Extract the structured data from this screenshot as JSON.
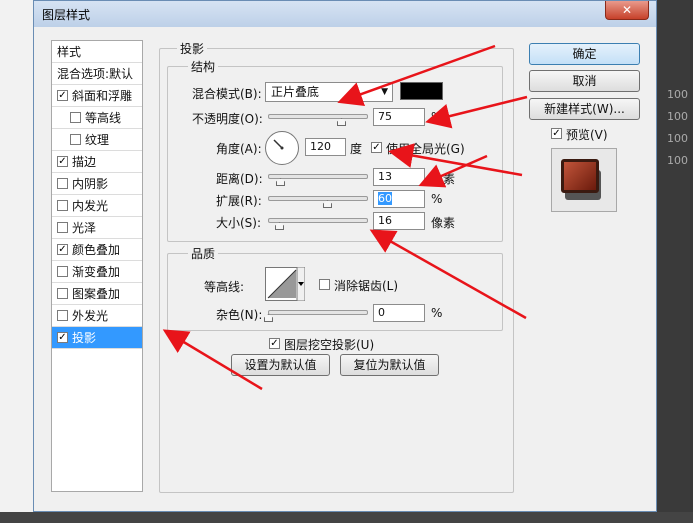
{
  "dialog": {
    "title": "图层样式",
    "close_label": "✕"
  },
  "styles": {
    "header": "样式",
    "blend_options": "混合选项:默认",
    "items": [
      {
        "label": "斜面和浮雕",
        "checked": true
      },
      {
        "label": "等高线",
        "checked": false,
        "sub": true
      },
      {
        "label": "纹理",
        "checked": false,
        "sub": true
      },
      {
        "label": "描边",
        "checked": true
      },
      {
        "label": "内阴影",
        "checked": false
      },
      {
        "label": "内发光",
        "checked": false
      },
      {
        "label": "光泽",
        "checked": false
      },
      {
        "label": "颜色叠加",
        "checked": true
      },
      {
        "label": "渐变叠加",
        "checked": false
      },
      {
        "label": "图案叠加",
        "checked": false
      },
      {
        "label": "外发光",
        "checked": false
      },
      {
        "label": "投影",
        "checked": true,
        "selected": true
      }
    ]
  },
  "shadow": {
    "title": "投影",
    "structure_title": "结构",
    "blend_mode_label": "混合模式(B):",
    "blend_mode_value": "正片叠底",
    "color_hex": "#000000",
    "opacity_label": "不透明度(O):",
    "opacity_value": "75",
    "opacity_unit": "%",
    "opacity_level": 0.75,
    "angle_label": "角度(A):",
    "angle_value": "120",
    "angle_unit": "度",
    "global_light_label": "使用全局光(G)",
    "global_light_checked": true,
    "distance_label": "距离(D):",
    "distance_value": "13",
    "distance_unit": "像素",
    "spread_label": "扩展(R):",
    "spread_value": "60",
    "spread_unit": "%",
    "size_label": "大小(S):",
    "size_value": "16",
    "size_unit": "像素",
    "quality_title": "品质",
    "contour_label": "等高线:",
    "antialias_label": "消除锯齿(L)",
    "antialias_checked": false,
    "noise_label": "杂色(N):",
    "noise_value": "0",
    "noise_unit": "%",
    "knockout_label": "图层挖空投影(U)",
    "knockout_checked": true,
    "set_default": "设置为默认值",
    "reset_default": "复位为默认值"
  },
  "actions": {
    "ok": "确定",
    "cancel": "取消",
    "new_style": "新建样式(W)...",
    "preview_label": "预览(V)",
    "preview_checked": true
  },
  "background": {
    "pct_labels": [
      "100",
      "100",
      "100",
      "100"
    ]
  },
  "colors": {
    "accent": "#3399ff",
    "annotation": "#e8141a",
    "preview_fill": "#8a2a14"
  }
}
